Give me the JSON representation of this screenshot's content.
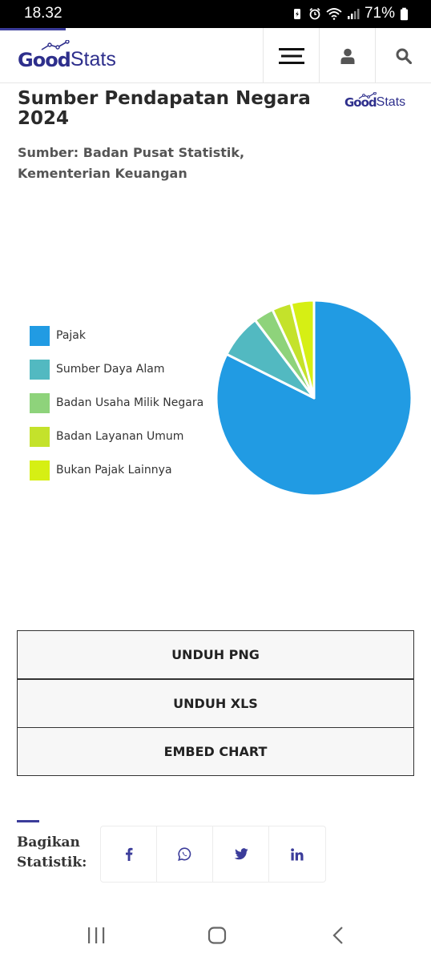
{
  "status_bar": {
    "time": "18.32",
    "battery": "71%"
  },
  "header": {
    "logo_good": "Good",
    "logo_stats": "Stats"
  },
  "chart_header": {
    "title": "Sumber Pendapatan Negara 2024",
    "source": "Sumber: Badan Pusat Statistik, Kementerian Keuangan",
    "logo_good": "Good",
    "logo_stats": "Stats"
  },
  "chart_data": {
    "type": "pie",
    "title": "Sumber Pendapatan Negara 2024",
    "legend_position": "left",
    "categories": [
      "Pajak",
      "Sumber Daya Alam",
      "Badan Usaha Milik Negara",
      "Badan Layanan Umum",
      "Bukan Pajak Lainnya"
    ],
    "values": [
      82.4,
      7.3,
      3.3,
      3.2,
      3.8
    ],
    "colors": [
      "#219be3",
      "#52b9c1",
      "#8ed37b",
      "#c4e22b",
      "#d6ef14"
    ]
  },
  "buttons": {
    "png": "UNDUH PNG",
    "xls": "UNDUH XLS",
    "embed": "EMBED CHART"
  },
  "share": {
    "label": "Bagikan Statistik:",
    "icons": [
      "facebook-icon",
      "whatsapp-icon",
      "twitter-icon",
      "linkedin-icon"
    ]
  },
  "colors": {
    "brand": "#2e2f8c",
    "share_icon": "#3b3c9a"
  }
}
